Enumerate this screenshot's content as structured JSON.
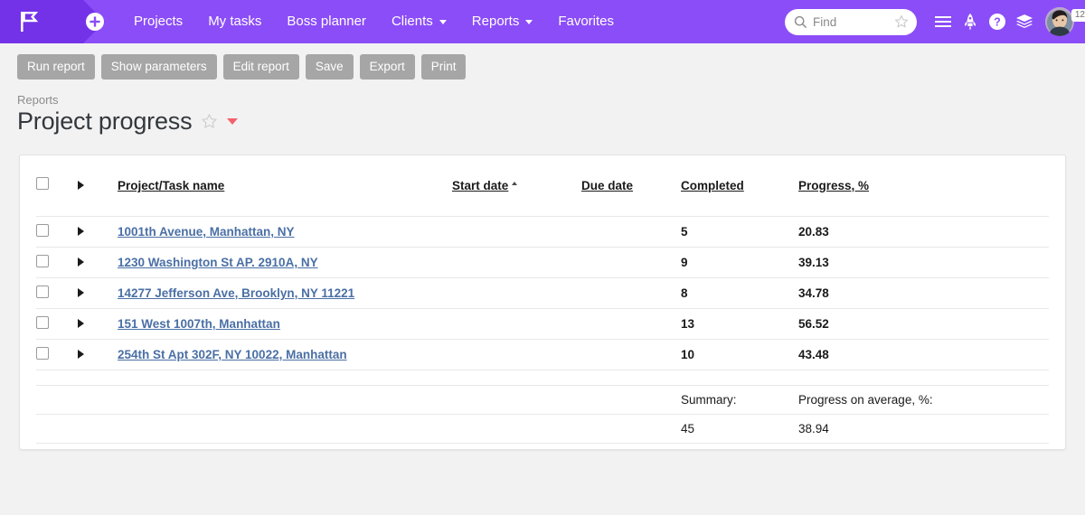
{
  "nav": {
    "logo_icon": "flag-icon",
    "add_icon": "plus-circle-icon",
    "links": [
      {
        "label": "Projects",
        "has_caret": false
      },
      {
        "label": "My tasks",
        "has_caret": false
      },
      {
        "label": "Boss planner",
        "has_caret": false
      },
      {
        "label": "Clients",
        "has_caret": true
      },
      {
        "label": "Reports",
        "has_caret": true
      },
      {
        "label": "Favorites",
        "has_caret": false
      }
    ],
    "search": {
      "placeholder": "Find",
      "value": "",
      "icon": "search-icon",
      "star_icon": "star-outline-icon"
    },
    "icons": [
      {
        "name": "hamburger-menu-icon"
      },
      {
        "name": "rocket-icon"
      },
      {
        "name": "help-circle-icon"
      },
      {
        "name": "layers-icon"
      }
    ],
    "avatar": {
      "name": "avatar",
      "badge": "12"
    },
    "accent_color": "#8b4df7",
    "logo_bg_color": "#7432e8"
  },
  "toolbar": {
    "buttons": [
      {
        "label": "Run report"
      },
      {
        "label": "Show parameters"
      },
      {
        "label": "Edit report"
      },
      {
        "label": "Save"
      },
      {
        "label": "Export"
      },
      {
        "label": "Print"
      }
    ],
    "button_color": "#a6a6a6"
  },
  "page": {
    "breadcrumb": "Reports",
    "title": "Project progress",
    "favorite_icon": "star-outline-icon",
    "dropdown_icon": "caret-down-icon",
    "dropdown_color": "#f4616d"
  },
  "table": {
    "headers": {
      "name": "Project/Task name",
      "start_date": "Start date",
      "due_date": "Due date",
      "completed": "Completed",
      "progress": "Progress, %"
    },
    "sort": {
      "column": "start_date",
      "direction": "asc"
    },
    "rows": [
      {
        "name": "1001th Avenue, Manhattan, NY",
        "start_date": "",
        "due_date": "",
        "completed": "5",
        "progress": "20.83"
      },
      {
        "name": "1230 Washington St AP. 2910A, NY",
        "start_date": "",
        "due_date": "",
        "completed": "9",
        "progress": "39.13"
      },
      {
        "name": "14277 Jefferson Ave, Brooklyn, NY 11221",
        "start_date": "",
        "due_date": "",
        "completed": "8",
        "progress": "34.78"
      },
      {
        "name": "151 West 1007th, Manhattan",
        "start_date": "",
        "due_date": "",
        "completed": "13",
        "progress": "56.52"
      },
      {
        "name": "254th St Apt 302F, NY 10022, Manhattan",
        "start_date": "",
        "due_date": "",
        "completed": "10",
        "progress": "43.48"
      }
    ],
    "summary": {
      "completed_label": "Summary:",
      "completed_value": "45",
      "progress_label": "Progress on average, %:",
      "progress_value": "38.94"
    },
    "link_color": "#4a6fa5"
  }
}
